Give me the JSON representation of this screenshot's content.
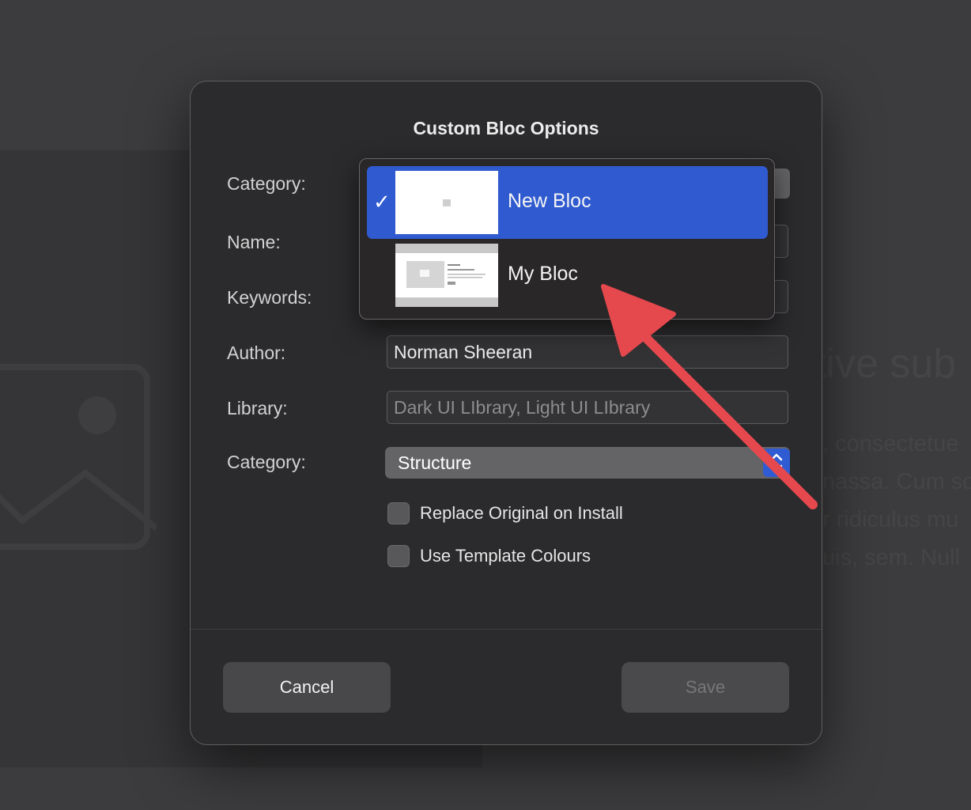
{
  "background": {
    "heading_fragment": "tive sub",
    "body_lines": ", consectetue|nassa. Cum so|r ridiculus mu|uis, sem. Null"
  },
  "dialog": {
    "title": "Custom Bloc Options",
    "fields": {
      "category_top_label": "Category:",
      "name_label": "Name:",
      "keywords_label": "Keywords:",
      "author_label": "Author:",
      "author_value": "Norman Sheeran",
      "library_label": "Library:",
      "library_placeholder": "Dark UI LIbrary, Light UI LIbrary",
      "category_label": "Category:",
      "category_value": "Structure"
    },
    "checkboxes": {
      "replace_original": "Replace Original on Install",
      "use_template_colours": "Use Template Colours"
    },
    "buttons": {
      "cancel": "Cancel",
      "save": "Save"
    }
  },
  "dropdown": {
    "items": [
      {
        "label": "New Bloc",
        "selected": true,
        "checkmark": "✓"
      },
      {
        "label": "My Bloc",
        "selected": false
      }
    ]
  },
  "colors": {
    "accent": "#2f5ad0",
    "annotation_arrow": "#e5484d"
  }
}
